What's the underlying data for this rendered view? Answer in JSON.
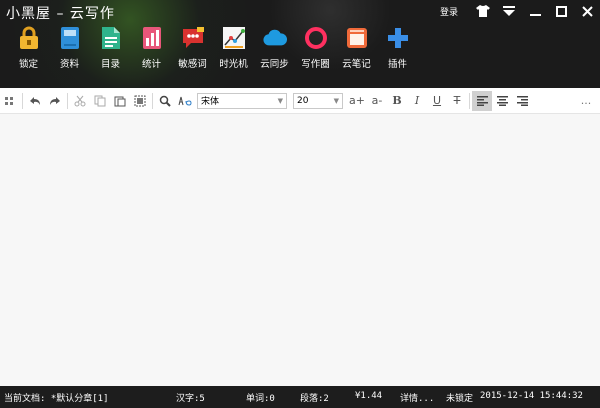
{
  "app": {
    "title": "小黑屋 – 云写作",
    "login_label": "登录"
  },
  "ribbon": [
    {
      "icon": "lock-icon",
      "label": "锁定",
      "color": "#f0b429"
    },
    {
      "icon": "book-icon",
      "label": "资料",
      "color": "#2f8fd8"
    },
    {
      "icon": "document-icon",
      "label": "目录",
      "color": "#2fb38c"
    },
    {
      "icon": "statistics-icon",
      "label": "统计",
      "color": "#e8577a"
    },
    {
      "icon": "chat-icon",
      "label": "敏感词",
      "color": "#d8322f"
    },
    {
      "icon": "chart-icon",
      "label": "时光机",
      "color": "#f0f0f0"
    },
    {
      "icon": "cloud-icon",
      "label": "云同步",
      "color": "#1e9ae0"
    },
    {
      "icon": "ring-icon",
      "label": "写作圈",
      "color": "#ff3060"
    },
    {
      "icon": "notebook-icon",
      "label": "云笔记",
      "color": "#f06a3a"
    },
    {
      "icon": "plus-icon",
      "label": "插件",
      "color": "#3a8ee6"
    }
  ],
  "toolbar": {
    "font": "宋体",
    "size": "20",
    "grow_label": "a+",
    "shrink_label": "a-",
    "bold_label": "B",
    "italic_label": "I",
    "underline_label": "U",
    "strike_label": "T",
    "more_label": "..."
  },
  "status": {
    "current_doc": "当前文档: *默认分章[1]",
    "chars": "汉字:5",
    "words": "单词:0",
    "paragraphs": "段落:2",
    "price": "¥1.44",
    "details": "详情...",
    "lock": "未锁定",
    "datetime": "2015-12-14 15:44:32"
  }
}
